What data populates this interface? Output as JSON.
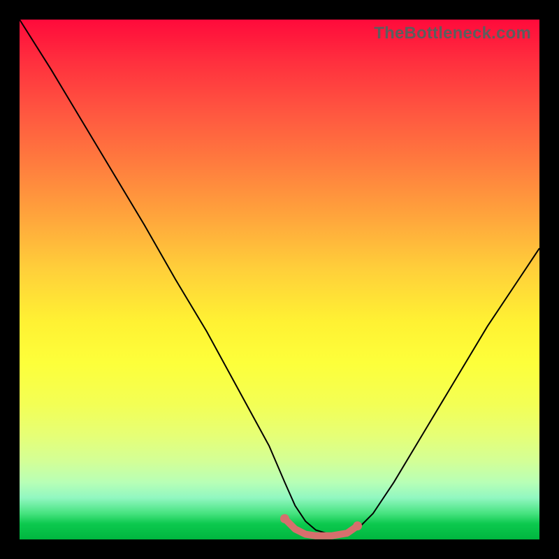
{
  "watermark": "TheBottleneck.com",
  "chart_data": {
    "type": "line",
    "title": "",
    "xlabel": "",
    "ylabel": "",
    "xlim": [
      0,
      100
    ],
    "ylim": [
      0,
      100
    ],
    "grid": false,
    "legend": false,
    "series": [
      {
        "name": "bottleneck-curve",
        "color": "#000000",
        "stroke_width": 2,
        "x": [
          0,
          6,
          12,
          18,
          24,
          30,
          36,
          42,
          48,
          51,
          53,
          55,
          57,
          60,
          63,
          65,
          68,
          72,
          78,
          84,
          90,
          96,
          100
        ],
        "y": [
          100,
          90.5,
          80.5,
          70.5,
          60.5,
          50,
          40,
          29,
          18,
          11,
          6.5,
          3.5,
          1.8,
          0.9,
          1.0,
          2.0,
          5.0,
          11,
          21,
          31,
          41,
          50,
          56
        ]
      },
      {
        "name": "optimal-zone",
        "color": "#d66f6d",
        "stroke_width": 10,
        "linecap": "round",
        "x": [
          51,
          53,
          55,
          57,
          60,
          63,
          65
        ],
        "y": [
          4.0,
          2.0,
          1.0,
          0.7,
          0.7,
          1.2,
          2.6
        ]
      }
    ]
  }
}
